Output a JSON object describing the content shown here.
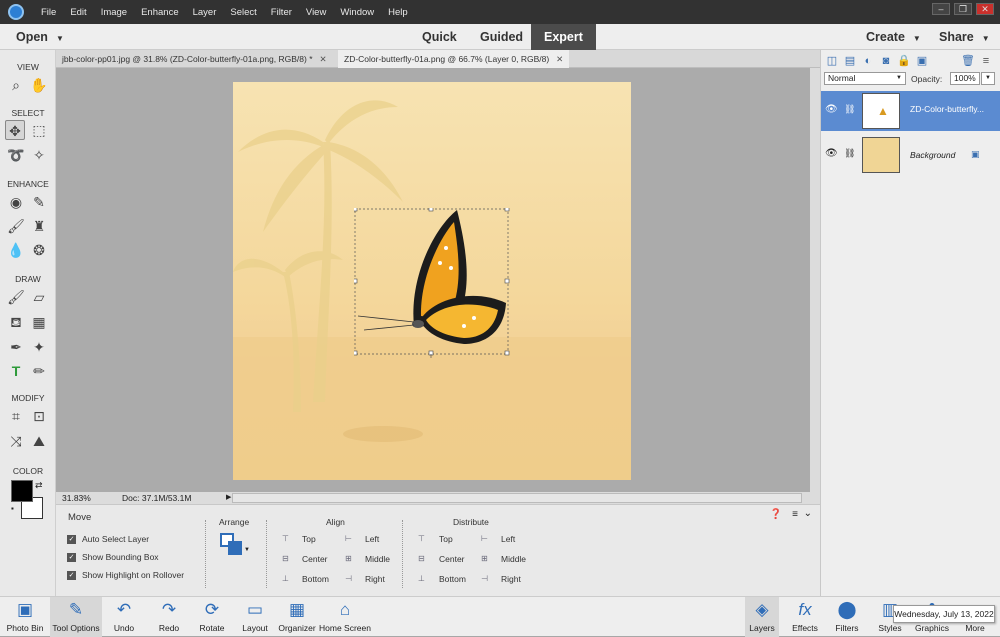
{
  "menu": [
    "File",
    "Edit",
    "Image",
    "Enhance",
    "Layer",
    "Select",
    "Filter",
    "View",
    "Window",
    "Help"
  ],
  "window_controls": [
    "–",
    "❐",
    "✕"
  ],
  "modebar": {
    "open": "Open",
    "quick": "Quick",
    "guided": "Guided",
    "expert": "Expert",
    "create": "Create",
    "share": "Share"
  },
  "tools": {
    "sections": [
      "VIEW",
      "SELECT",
      "ENHANCE",
      "DRAW",
      "MODIFY",
      "COLOR"
    ]
  },
  "tabs": [
    {
      "label": "jbb-color-pp01.jpg @ 31.8% (ZD-Color-butterfly-01a.png, RGB/8) *",
      "close": "✕"
    },
    {
      "label": "ZD-Color-butterfly-01a.png @ 66.7% (Layer 0, RGB/8)",
      "close": "✕"
    }
  ],
  "status": {
    "zoom": "31.83%",
    "doc": "Doc: 37.1M/53.1M"
  },
  "options": {
    "title": "Move",
    "checks": [
      "Auto Select Layer",
      "Show Bounding Box",
      "Show Highlight on Rollover"
    ],
    "arrange": "Arrange",
    "align": {
      "title": "Align",
      "items": [
        "Top",
        "Center",
        "Bottom",
        "Left",
        "Middle",
        "Right"
      ]
    },
    "distribute": {
      "title": "Distribute",
      "items": [
        "Top",
        "Center",
        "Bottom",
        "Left",
        "Middle",
        "Right"
      ]
    }
  },
  "layers": {
    "blend_mode": "Normal",
    "opacity_label": "Opacity:",
    "opacity": "100%",
    "items": [
      {
        "name": "ZD-Color-butterfly..."
      },
      {
        "name": "Background"
      }
    ]
  },
  "bottombar": [
    "Photo Bin",
    "Tool Options",
    "Undo",
    "Redo",
    "Rotate",
    "Layout",
    "Organizer",
    "Home Screen",
    "Layers",
    "Effects",
    "Filters",
    "Styles",
    "Graphics",
    "More"
  ],
  "tooltip": "Wednesday, July 13, 2022",
  "colors": {
    "accent": "#2f6db8",
    "selected_layer": "#5b8bd1",
    "dark_bar": "#323232"
  }
}
